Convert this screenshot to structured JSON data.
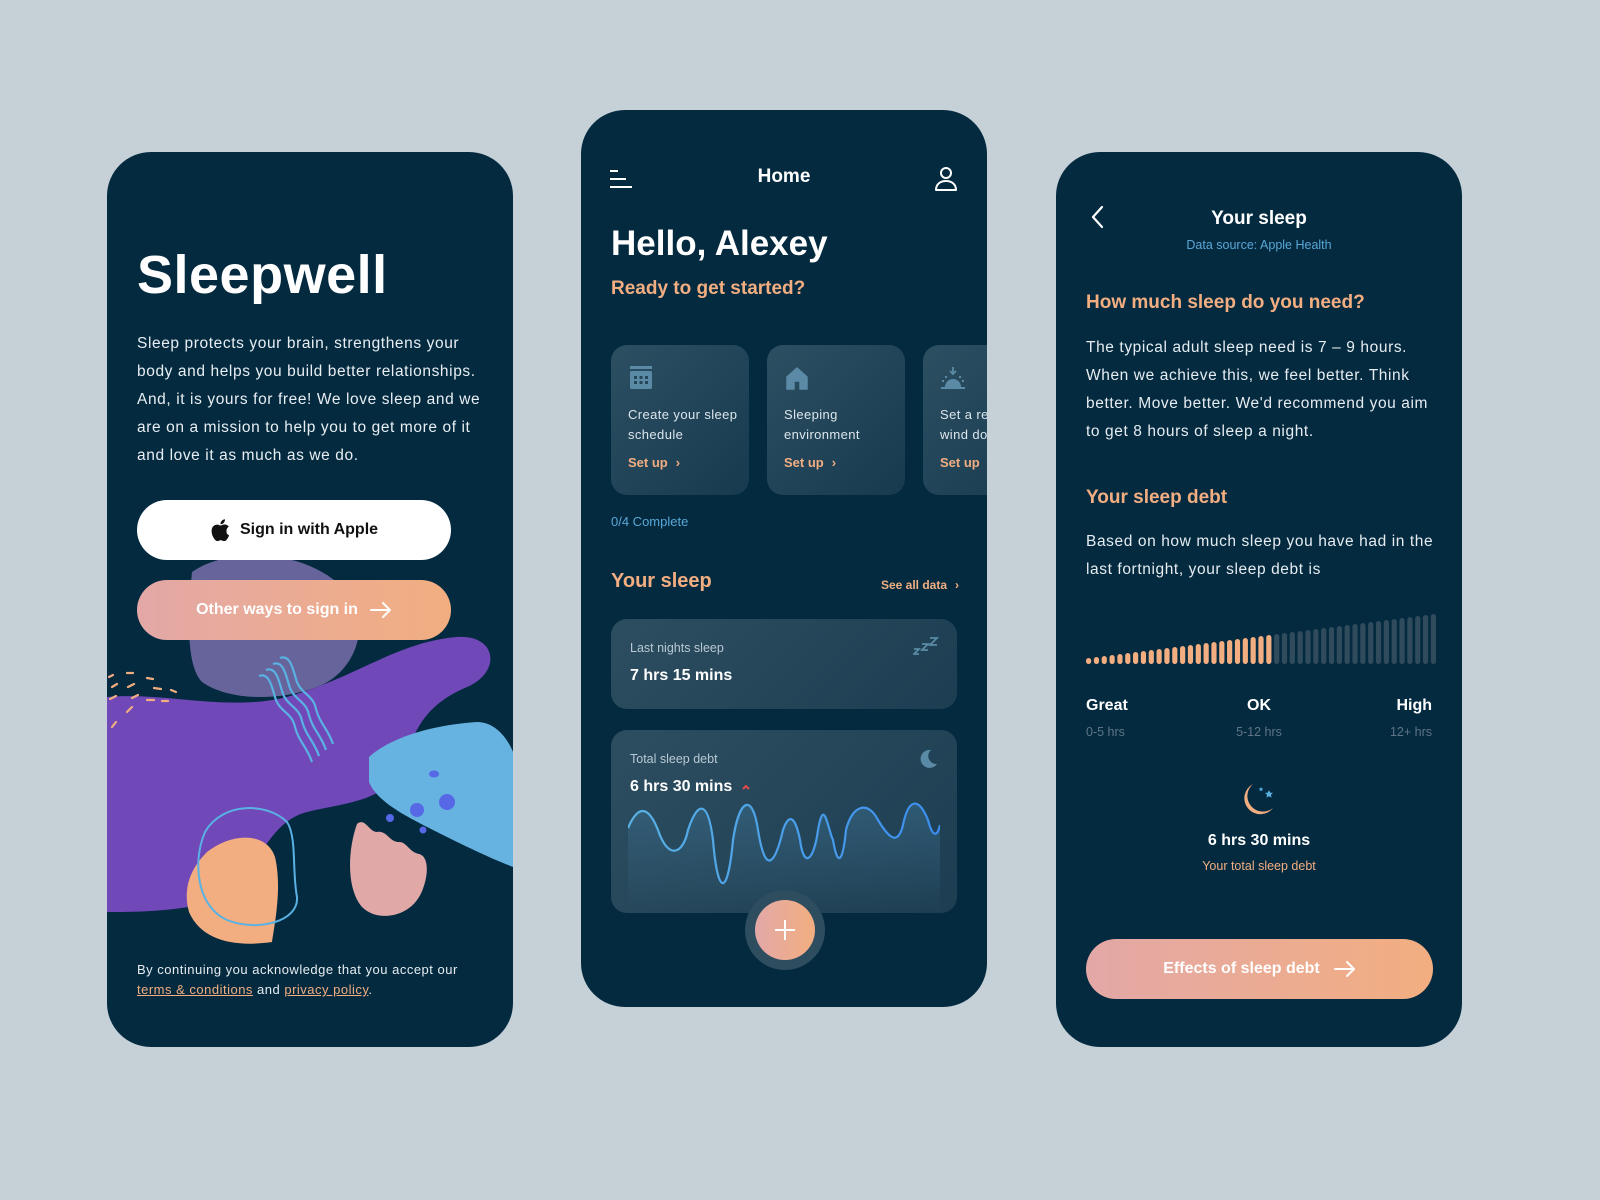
{
  "colors": {
    "background": "#c5d0d7",
    "phone_bg": "#042a40",
    "accent_peach": "#f2ae80",
    "accent_pink": "#e3a8a7",
    "accent_blue": "#5aa7d6",
    "bar_inactive": "#2f4b5c",
    "alert_red": "#e84a4a"
  },
  "onboarding": {
    "app_title": "Sleepwell",
    "description": "Sleep protects your brain, strengthens your body and helps you build better relationships. And, it is yours for free!  We love sleep and we are on a mission to help you to get more of it and love it as much as we do.",
    "apple_button_label": "Sign in with Apple",
    "other_button_label": "Other ways to sign in",
    "legal_prefix": "By continuing you acknowledge that you accept our ",
    "terms_link": "terms & conditions",
    "legal_and": " and ",
    "privacy_link": "privacy policy",
    "legal_suffix": "."
  },
  "home": {
    "header_title": "Home",
    "greeting": "Hello, Alexey",
    "subtitle": "Ready to get started?",
    "cards": [
      {
        "icon": "calendar-icon",
        "title": "Create your sleep schedule",
        "action": "Set up"
      },
      {
        "icon": "home-icon",
        "title": "Sleeping environment",
        "action": "Set up"
      },
      {
        "icon": "sunrise-icon",
        "title": "Set a reminder to wind down",
        "action": "Set up"
      }
    ],
    "progress_text": "0/4 Complete",
    "progress": {
      "completed": 0,
      "total": 4
    },
    "section_title": "Your sleep",
    "see_all_label": "See all data",
    "last_night": {
      "label": "Last nights sleep",
      "value": "7 hrs 15 mins",
      "icon": "zzz-icon"
    },
    "sleep_debt": {
      "label": "Total sleep debt",
      "value": "6 hrs 30 mins",
      "trend": "up",
      "icon": "moon-icon"
    }
  },
  "your_sleep": {
    "header_title": "Your sleep",
    "data_source": "Data source: Apple Health",
    "need_heading": "How much sleep do you need?",
    "need_body": "The typical adult sleep need is 7 – 9 hours. When we achieve this, we feel better. Think better. Move better. We'd recommend you aim to get 8 hours of sleep a night.",
    "debt_heading": "Your sleep debt",
    "debt_body": "Based on how much sleep you have had in the last fortnight, your sleep debt is",
    "scale": {
      "total_bars": 45,
      "filled_bars": 24,
      "levels": [
        {
          "label": "Great",
          "range": "0-5 hrs"
        },
        {
          "label": "OK",
          "range": "5-12 hrs"
        },
        {
          "label": "High",
          "range": "12+ hrs"
        }
      ]
    },
    "debt_value": "6 hrs 30 mins",
    "debt_caption": "Your total sleep debt",
    "effects_button_label": "Effects of sleep debt"
  }
}
